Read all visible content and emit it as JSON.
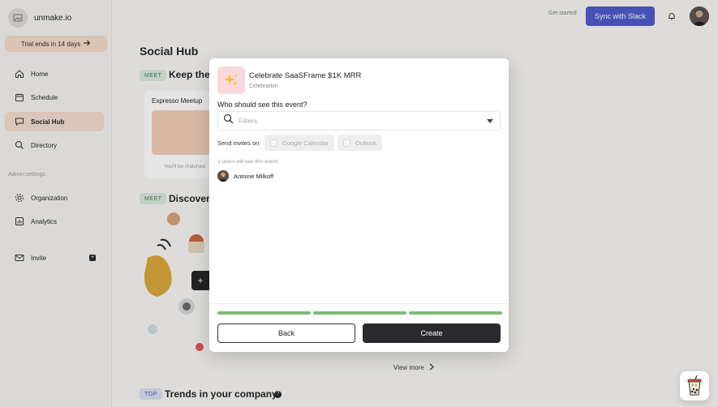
{
  "app": {
    "brand_name": "unmake.io",
    "trial_text": "Trial ends in 14 days"
  },
  "sidebar": {
    "items": [
      {
        "label": "Home",
        "icon": "home-icon"
      },
      {
        "label": "Schedule",
        "icon": "calendar-icon"
      },
      {
        "label": "Social Hub",
        "icon": "chat-icon",
        "active": true
      },
      {
        "label": "Directory",
        "icon": "search-icon"
      }
    ],
    "admin_label": "Admin settings",
    "admin_items": [
      {
        "label": "Organization",
        "icon": "gear-icon"
      },
      {
        "label": "Analytics",
        "icon": "chart-icon"
      }
    ],
    "invite_label": "Invite"
  },
  "topbar": {
    "get_started": "Get started",
    "slack_button": "Sync with Slack"
  },
  "main": {
    "title": "Social Hub",
    "section1": {
      "tag": "MEET",
      "title": "Keep the"
    },
    "card": {
      "title": "Expresso Meetup",
      "footer": "You'll be matched"
    },
    "section2": {
      "tag": "MEET",
      "title": "Discover"
    },
    "view_more": "View more",
    "section3": {
      "tag": "TOP",
      "title": "Trends in your company"
    }
  },
  "modal": {
    "event_title": "Celebrate SaaSFrame $1K MRR",
    "event_type": "Celebration",
    "question": "Who should see this event?",
    "filter_placeholder": "Filters",
    "invites_label": "Send invites on",
    "invite_options": [
      "Google Calendar",
      "Outlook"
    ],
    "users_count_text": "1 users will see this event:",
    "users": [
      "Antoine Milkoff"
    ],
    "progress_steps_complete": 3,
    "progress_steps_total": 3,
    "back_label": "Back",
    "create_label": "Create"
  },
  "colors": {
    "accent_slack": "#4c57c9",
    "active_nav": "#efdccd",
    "progress": "#7fba7a",
    "create_button": "#2a2a2e"
  }
}
